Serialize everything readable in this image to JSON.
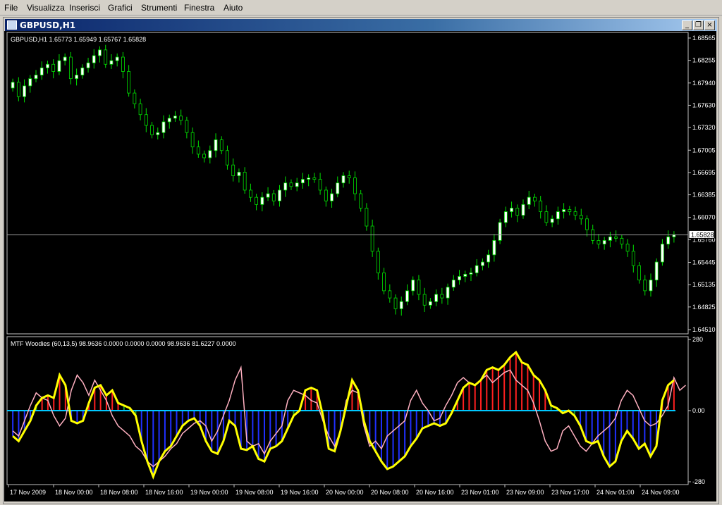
{
  "menu": [
    "File",
    "Visualizza",
    "Inserisci",
    "Grafici",
    "Strumenti",
    "Finestra",
    "Aiuto"
  ],
  "window": {
    "title": "GBPUSD,H1",
    "minimize": "_",
    "restore": "❐",
    "close": "×"
  },
  "main_chart": {
    "label": "GBPUSD,H1  1.65773 1.65949 1.65767 1.65828",
    "y_ticks": [
      "1.68565",
      "1.68255",
      "1.67940",
      "1.67630",
      "1.67320",
      "1.67005",
      "1.66695",
      "1.66385",
      "1.66070",
      "1.65760",
      "1.65445",
      "1.65135",
      "1.64825",
      "1.64510"
    ],
    "current_price": "1.65828",
    "current_price_value": 1.65828,
    "ylim": [
      1.6451,
      1.68565
    ],
    "bull_color": "#ffffff",
    "wick_color": "#00e000",
    "closes": [
      1.6795,
      1.6775,
      1.679,
      1.68,
      1.6805,
      1.6815,
      1.682,
      1.681,
      1.6825,
      1.683,
      1.68,
      1.6805,
      1.6815,
      1.6822,
      1.6832,
      1.684,
      1.682,
      1.6825,
      1.683,
      1.681,
      1.678,
      1.6765,
      1.675,
      1.6735,
      1.6722,
      1.6725,
      1.674,
      1.6745,
      1.6748,
      1.6742,
      1.6725,
      1.6705,
      1.6695,
      1.669,
      1.67,
      1.6715,
      1.67,
      1.668,
      1.6665,
      1.667,
      1.6645,
      1.6635,
      1.6625,
      1.6635,
      1.664,
      1.663,
      1.6645,
      1.6655,
      1.665,
      1.6655,
      1.666,
      1.6662,
      1.666,
      1.6645,
      1.663,
      1.664,
      1.6655,
      1.6665,
      1.6662,
      1.664,
      1.662,
      1.6595,
      1.656,
      1.653,
      1.6505,
      1.6495,
      1.648,
      1.649,
      1.6505,
      1.652,
      1.65,
      1.6485,
      1.649,
      1.65,
      1.6495,
      1.651,
      1.652,
      1.6525,
      1.6528,
      1.653,
      1.654,
      1.6545,
      1.6555,
      1.6575,
      1.66,
      1.6615,
      1.662,
      1.661,
      1.6625,
      1.6635,
      1.663,
      1.6615,
      1.66,
      1.6605,
      1.6615,
      1.6618,
      1.6615,
      1.661,
      1.6605,
      1.659,
      1.6575,
      1.657,
      1.6575,
      1.658,
      1.6578,
      1.657,
      1.656,
      1.654,
      1.652,
      1.6505,
      1.652,
      1.6545,
      1.657,
      1.658,
      1.6583
    ]
  },
  "indicator": {
    "label": "MTF Woodies (60,13,5) 98.9636 0.0000 0.0000 0.0000 98.9636 81.6227 0.0000",
    "y_ticks": [
      "280",
      "0.00",
      "-280"
    ],
    "ylim": [
      -280,
      280
    ],
    "zero_color": "#00c8ff",
    "line_color": "#ffff00",
    "signal_color": "#ffb0c0",
    "pos_color": "#ff2020",
    "neg_color": "#2030ff",
    "green_color": "#20a020",
    "values": [
      -100,
      -120,
      -80,
      -40,
      20,
      50,
      60,
      50,
      140,
      100,
      -40,
      -50,
      -40,
      30,
      90,
      100,
      60,
      80,
      30,
      20,
      10,
      -20,
      -120,
      -200,
      -260,
      -200,
      -160,
      -140,
      -100,
      -60,
      -40,
      -30,
      -60,
      -120,
      -160,
      -170,
      -120,
      -40,
      -60,
      -150,
      -155,
      -140,
      -190,
      -200,
      -150,
      -140,
      -120,
      -70,
      -20,
      0,
      80,
      90,
      80,
      -20,
      -150,
      -160,
      -80,
      20,
      120,
      80,
      -40,
      -120,
      -160,
      -200,
      -230,
      -220,
      -200,
      -180,
      -140,
      -110,
      -70,
      -60,
      -50,
      -60,
      -50,
      -10,
      40,
      90,
      110,
      100,
      120,
      160,
      170,
      160,
      180,
      210,
      230,
      190,
      180,
      140,
      120,
      80,
      20,
      10,
      -10,
      0,
      -20,
      -60,
      -120,
      -130,
      -120,
      -180,
      -220,
      -200,
      -120,
      -80,
      -110,
      -150,
      -130,
      -180,
      -140,
      40,
      100,
      120
    ],
    "signal": [
      -80,
      -100,
      -40,
      20,
      70,
      50,
      40,
      -20,
      -60,
      -30,
      80,
      140,
      110,
      60,
      120,
      80,
      40,
      -20,
      -60,
      -80,
      -100,
      -140,
      -160,
      -200,
      -220,
      -200,
      -180,
      -150,
      -130,
      -90,
      -70,
      -50,
      -40,
      -60,
      -120,
      -80,
      -20,
      40,
      120,
      170,
      -120,
      -140,
      -130,
      -170,
      -120,
      -90,
      -60,
      40,
      80,
      70,
      60,
      40,
      30,
      -40,
      -100,
      -140,
      -80,
      40,
      80,
      70,
      -60,
      -140,
      -120,
      -150,
      -100,
      -80,
      -60,
      -40,
      40,
      80,
      30,
      0,
      -40,
      -30,
      20,
      60,
      110,
      130,
      110,
      100,
      120,
      140,
      110,
      130,
      150,
      160,
      120,
      100,
      80,
      30,
      -40,
      -120,
      -160,
      -150,
      -80,
      -60,
      -100,
      -140,
      -160,
      -130,
      -100,
      -80,
      -60,
      -30,
      40,
      80,
      60,
      10,
      -40,
      -60,
      -50,
      -20,
      20,
      130,
      80,
      100
    ]
  },
  "x_labels": [
    "17 Nov 2009",
    "18 Nov 00:00",
    "18 Nov 08:00",
    "18 Nov 16:00",
    "19 Nov 00:00",
    "19 Nov 08:00",
    "19 Nov 16:00",
    "20 Nov 00:00",
    "20 Nov 08:00",
    "20 Nov 16:00",
    "23 Nov 01:00",
    "23 Nov 09:00",
    "23 Nov 17:00",
    "24 Nov 01:00",
    "24 Nov 09:00"
  ]
}
